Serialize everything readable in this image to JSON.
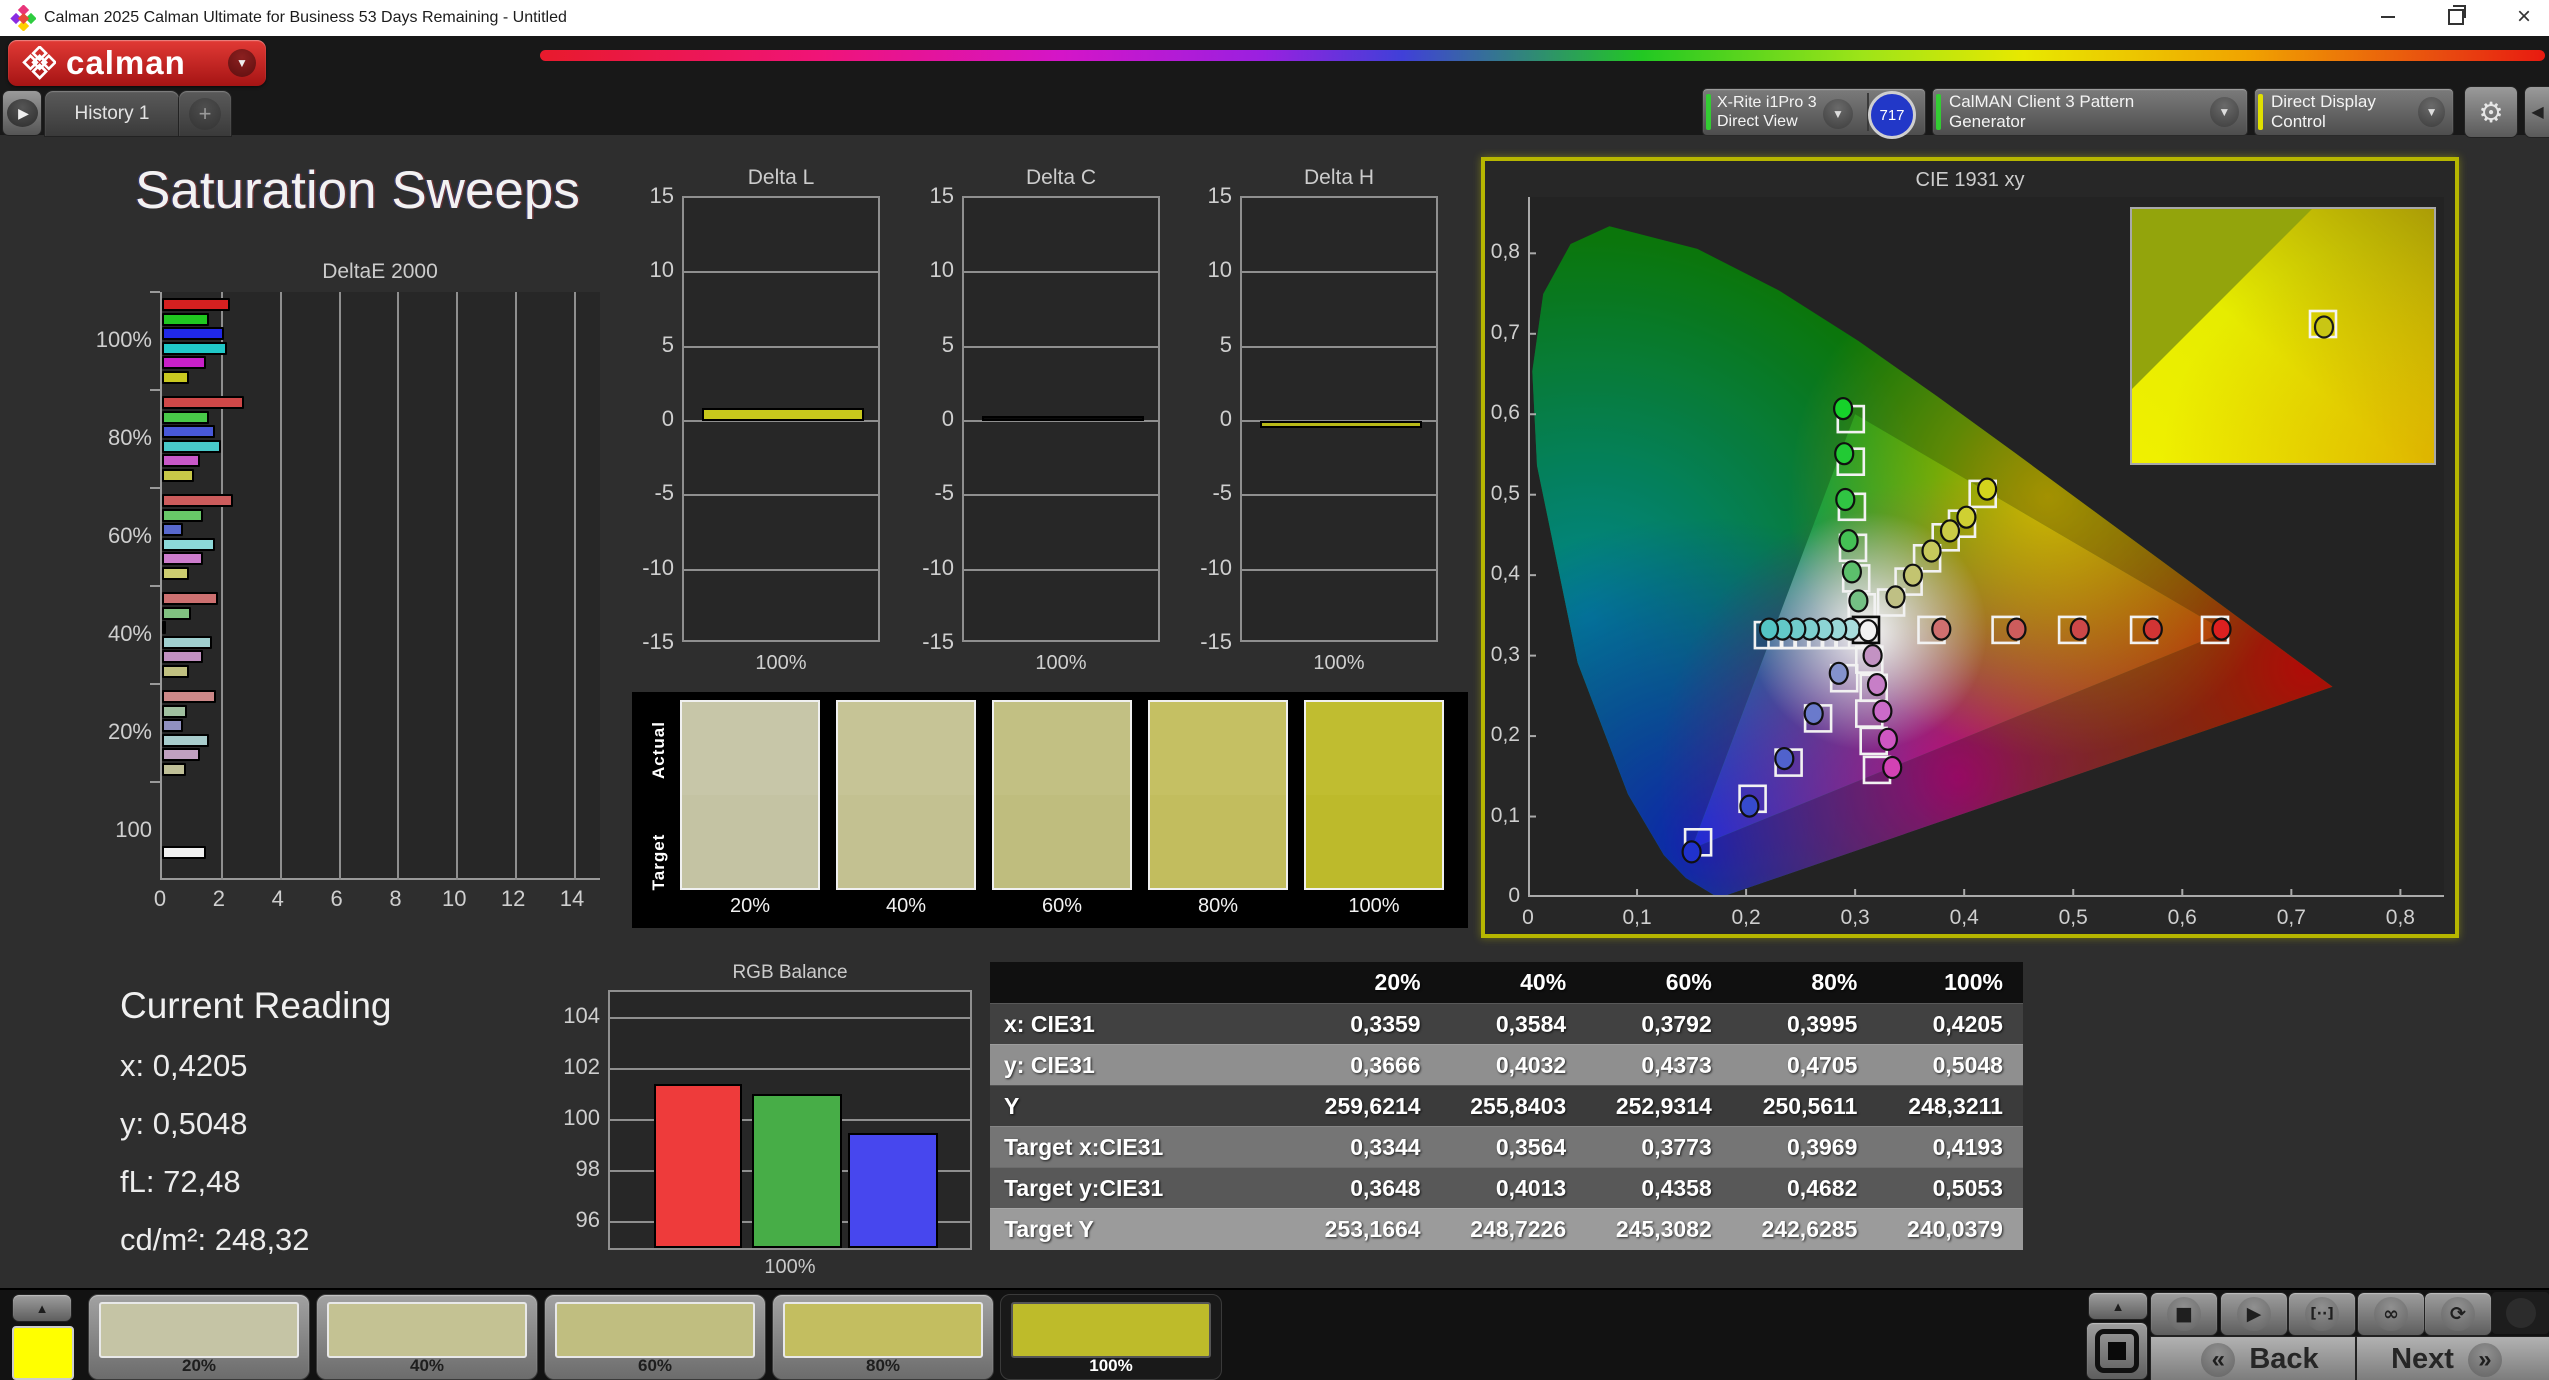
{
  "window": {
    "title": "Calman 2025 Calman Ultimate for Business 53 Days Remaining  - Untitled"
  },
  "header": {
    "logo_text": "calman"
  },
  "tab_bar": {
    "active_tab": "History 1",
    "add_tab": "+"
  },
  "toolbar": {
    "meter_device": "X-Rite i1Pro 3",
    "meter_mode": "Direct View",
    "meter_badge": "717",
    "meter_status_color": "#33cc33",
    "pattern_generator": "CalMAN Client 3 Pattern Generator",
    "pattern_status_color": "#33cc33",
    "display_control": "Direct Display Control",
    "display_status_color": "#e0e000"
  },
  "page_title": "Saturation Sweeps",
  "current_reading": {
    "title": "Current Reading",
    "lines": [
      "x: 0,4205",
      "y: 0,5048",
      "fL: 72,48",
      "cd/m²: 248,32"
    ]
  },
  "swatch_panel": {
    "row_labels": [
      "Actual",
      "Target"
    ],
    "items": [
      {
        "label": "20%",
        "actual": "#c7c6a8",
        "target": "#c4c3a3"
      },
      {
        "label": "40%",
        "actual": "#c6c496",
        "target": "#c3c191"
      },
      {
        "label": "60%",
        "actual": "#c2c083",
        "target": "#bfbd7e"
      },
      {
        "label": "80%",
        "actual": "#c5c063",
        "target": "#c2bd5e"
      },
      {
        "label": "100%",
        "actual": "#c0bd30",
        "target": "#bdba2b"
      }
    ]
  },
  "table": {
    "columns": [
      "",
      "20%",
      "40%",
      "60%",
      "80%",
      "100%"
    ],
    "rows": [
      {
        "label": "x: CIE31",
        "values": [
          "0,3359",
          "0,3584",
          "0,3792",
          "0,3995",
          "0,4205"
        ]
      },
      {
        "label": "y: CIE31",
        "values": [
          "0,3666",
          "0,4032",
          "0,4373",
          "0,4705",
          "0,5048"
        ]
      },
      {
        "label": "Y",
        "values": [
          "259,6214",
          "255,8403",
          "252,9314",
          "250,5611",
          "248,3211"
        ]
      },
      {
        "label": "Target x:CIE31",
        "values": [
          "0,3344",
          "0,3564",
          "0,3773",
          "0,3969",
          "0,4193"
        ]
      },
      {
        "label": "Target y:CIE31",
        "values": [
          "0,3648",
          "0,4013",
          "0,4358",
          "0,4682",
          "0,5053"
        ]
      },
      {
        "label": "Target Y",
        "values": [
          "253,1664",
          "248,7226",
          "245,3082",
          "242,6285",
          "240,0379"
        ]
      }
    ]
  },
  "chart_data": [
    {
      "id": "deltae2000",
      "type": "bar",
      "orientation": "horizontal",
      "title": "DeltaE 2000",
      "xlim": [
        0,
        14
      ],
      "x_ticks": [
        0,
        2,
        4,
        6,
        8,
        10,
        12,
        14
      ],
      "grid": true,
      "groups": [
        {
          "label": "100%",
          "values": [
            2.3,
            1.6,
            2.1,
            2.2,
            1.5,
            0.9
          ],
          "colors": [
            "#d42020",
            "#20c820",
            "#2028e8",
            "#20c8c8",
            "#c820c8",
            "#c8c820"
          ]
        },
        {
          "label": "80%",
          "values": [
            2.8,
            1.6,
            1.8,
            2.0,
            1.3,
            1.1
          ],
          "colors": [
            "#d04848",
            "#48c848",
            "#4858d8",
            "#48c8c8",
            "#c858c8",
            "#c8c848"
          ]
        },
        {
          "label": "60%",
          "values": [
            2.4,
            1.4,
            0.7,
            1.8,
            1.4,
            0.9
          ],
          "colors": [
            "#cc5c5c",
            "#68c868",
            "#5868cc",
            "#8cd8d8",
            "#cc7ccc",
            "#cccc70"
          ]
        },
        {
          "label": "40%",
          "values": [
            1.9,
            1.0,
            0.15,
            1.7,
            1.4,
            0.9
          ],
          "colors": [
            "#cc7070",
            "#80c080",
            "#8080c0",
            "#a0d0d0",
            "#c090c0",
            "#c0c080"
          ]
        },
        {
          "label": "20%",
          "values": [
            1.85,
            0.85,
            0.7,
            1.6,
            1.3,
            0.8
          ],
          "colors": [
            "#cc8888",
            "#a0c0a0",
            "#9090c0",
            "#a8cccc",
            "#c0a0c0",
            "#c0c098"
          ]
        },
        {
          "label": "100",
          "values": [
            1.5
          ],
          "colors": [
            "#f0f0f0"
          ],
          "single_slot": 4
        }
      ]
    },
    {
      "id": "delta_l",
      "type": "bar",
      "title": "Delta L",
      "ylim": [
        -15,
        15
      ],
      "y_ticks": [
        15,
        10,
        5,
        0,
        -5,
        -10,
        -15
      ],
      "categories": [
        "100%"
      ],
      "values": [
        0.9
      ],
      "bar_color": "#c8c81c"
    },
    {
      "id": "delta_c",
      "type": "bar",
      "title": "Delta C",
      "ylim": [
        -15,
        15
      ],
      "y_ticks": [
        15,
        10,
        5,
        0,
        -5,
        -10,
        -15
      ],
      "categories": [
        "100%"
      ],
      "values": [
        0.2
      ],
      "bar_color": "#0a0a0a"
    },
    {
      "id": "delta_h",
      "type": "bar",
      "title": "Delta H",
      "ylim": [
        -15,
        15
      ],
      "y_ticks": [
        15,
        10,
        5,
        0,
        -5,
        -10,
        -15
      ],
      "categories": [
        "100%"
      ],
      "values": [
        -0.5
      ],
      "bar_color": "#b8b818"
    },
    {
      "id": "rgb_balance",
      "type": "bar",
      "title": "RGB Balance",
      "ylim": [
        95,
        105
      ],
      "y_ticks": [
        104,
        102,
        100,
        98,
        96
      ],
      "categories": [
        "100%"
      ],
      "series": [
        {
          "name": "Red",
          "value": 101.4,
          "color": "#ee3b3b"
        },
        {
          "name": "Green",
          "value": 101.0,
          "color": "#47ad47"
        },
        {
          "name": "Blue",
          "value": 99.5,
          "color": "#4747ee"
        }
      ]
    },
    {
      "id": "cie1931",
      "type": "scatter",
      "title": "CIE 1931 xy",
      "xlim": [
        0,
        0.84
      ],
      "ylim": [
        0,
        0.87
      ],
      "x_ticks": [
        "0",
        "0,1",
        "0,2",
        "0,3",
        "0,4",
        "0,5",
        "0,6",
        "0,7",
        "0,8"
      ],
      "y_ticks": [
        "0",
        "0,1",
        "0,2",
        "0,3",
        "0,4",
        "0,5",
        "0,6",
        "0,7",
        "0,8"
      ],
      "gamut_triangle": [
        [
          0.64,
          0.33
        ],
        [
          0.3,
          0.6
        ],
        [
          0.15,
          0.06
        ]
      ],
      "white_point": {
        "measured": [
          0.312,
          0.331
        ],
        "target": [
          0.31,
          0.332
        ]
      },
      "sweeps": [
        {
          "name": "red",
          "measured": [
            [
              0.379,
              0.333,
              "#cf6f6f"
            ],
            [
              0.448,
              0.333,
              "#cd5c5c"
            ],
            [
              0.506,
              0.333,
              "#cc4848"
            ],
            [
              0.573,
              0.333,
              "#d23434"
            ],
            [
              0.636,
              0.333,
              "#dc2020"
            ]
          ],
          "targets": [
            [
              0.37,
              0.332
            ],
            [
              0.438,
              0.332
            ],
            [
              0.499,
              0.332
            ],
            [
              0.565,
              0.332
            ],
            [
              0.63,
              0.332
            ]
          ]
        },
        {
          "name": "green",
          "measured": [
            [
              0.303,
              0.368,
              "#74c084"
            ],
            [
              0.297,
              0.404,
              "#5cc06c"
            ],
            [
              0.294,
              0.443,
              "#44c054"
            ],
            [
              0.291,
              0.494,
              "#30c443"
            ],
            [
              0.29,
              0.551,
              "#22ca34"
            ],
            [
              0.289,
              0.607,
              "#16d22a"
            ]
          ],
          "targets": [
            [
              0.306,
              0.36
            ],
            [
              0.301,
              0.396
            ],
            [
              0.298,
              0.434
            ],
            [
              0.297,
              0.485
            ],
            [
              0.296,
              0.541
            ],
            [
              0.296,
              0.594
            ]
          ]
        },
        {
          "name": "blue",
          "measured": [
            [
              0.285,
              0.278,
              "#8492cc"
            ],
            [
              0.262,
              0.228,
              "#6a7acc"
            ],
            [
              0.235,
              0.172,
              "#5062cc"
            ],
            [
              0.203,
              0.113,
              "#364acc"
            ],
            [
              0.15,
              0.056,
              "#2032cc"
            ]
          ],
          "targets": [
            [
              0.29,
              0.272
            ],
            [
              0.266,
              0.222
            ],
            [
              0.239,
              0.167
            ],
            [
              0.206,
              0.122
            ],
            [
              0.156,
              0.068
            ]
          ]
        },
        {
          "name": "cyan",
          "measured": [
            [
              0.296,
              0.333,
              "#a8dcdc"
            ],
            [
              0.2835,
              0.333,
              "#9ad8d8"
            ],
            [
              0.271,
              0.333,
              "#8cd4d4"
            ],
            [
              0.2585,
              0.333,
              "#7ed0d0"
            ],
            [
              0.246,
              0.333,
              "#70cccc"
            ],
            [
              0.2335,
              0.333,
              "#62c8c8"
            ],
            [
              0.221,
              0.333,
              "#54c4c4"
            ]
          ],
          "targets": [
            [
              0.295,
              0.3255
            ],
            [
              0.2825,
              0.3255
            ],
            [
              0.27,
              0.3255
            ],
            [
              0.2575,
              0.3255
            ],
            [
              0.245,
              0.3255
            ],
            [
              0.2325,
              0.3255
            ],
            [
              0.22,
              0.3255
            ]
          ]
        },
        {
          "name": "magenta",
          "measured": [
            [
              0.316,
              0.3,
              "#c392c3"
            ],
            [
              0.32,
              0.264,
              "#c77ec7"
            ],
            [
              0.325,
              0.231,
              "#cb6ac9"
            ],
            [
              0.33,
              0.196,
              "#cf56c3"
            ],
            [
              0.334,
              0.161,
              "#d342b4"
            ]
          ],
          "targets": [
            [
              0.313,
              0.295
            ],
            [
              0.317,
              0.26
            ],
            [
              0.313,
              0.228
            ],
            [
              0.317,
              0.194
            ],
            [
              0.32,
              0.158
            ]
          ]
        },
        {
          "name": "yellow",
          "measured": [
            [
              0.337,
              0.373,
              "#bfc084"
            ],
            [
              0.353,
              0.4,
              "#c3c470"
            ],
            [
              0.37,
              0.43,
              "#c7c85c"
            ],
            [
              0.387,
              0.455,
              "#cbcc46"
            ],
            [
              0.402,
              0.472,
              "#cfd032"
            ],
            [
              0.421,
              0.507,
              "#d4d41c"
            ]
          ],
          "targets": [
            [
              0.333,
              0.366
            ],
            [
              0.349,
              0.392
            ],
            [
              0.366,
              0.421
            ],
            [
              0.383,
              0.447
            ],
            [
              0.398,
              0.464
            ],
            [
              0.417,
              0.501
            ]
          ]
        }
      ],
      "inset_marker": [
        0.421,
        0.507
      ]
    }
  ],
  "bottom_bar": {
    "active_color": "#ffff00",
    "patterns": [
      {
        "label": "20%",
        "color": "#c5c4a5",
        "selected": false
      },
      {
        "label": "40%",
        "color": "#c4c293",
        "selected": false
      },
      {
        "label": "60%",
        "color": "#c0be80",
        "selected": false
      },
      {
        "label": "80%",
        "color": "#c3be60",
        "selected": false
      },
      {
        "label": "100%",
        "color": "#bebb2a",
        "selected": true
      }
    ],
    "transport": [
      {
        "name": "stop",
        "glyph": "■"
      },
      {
        "name": "play",
        "glyph": "▶"
      },
      {
        "name": "frame-step",
        "glyph": "[··]"
      },
      {
        "name": "loop",
        "glyph": "∞"
      },
      {
        "name": "refresh",
        "glyph": "⟳"
      }
    ],
    "back_label": "Back",
    "next_label": "Next",
    "back_glyph": "«",
    "next_glyph": "»"
  }
}
